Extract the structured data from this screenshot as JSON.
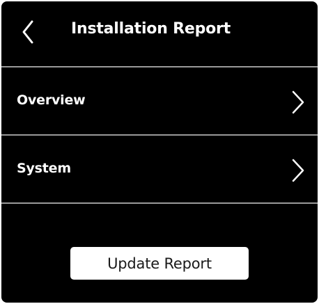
{
  "header": {
    "title": "Installation Report",
    "back_icon": "chevron-left-icon"
  },
  "menu": {
    "items": [
      {
        "label": "Overview",
        "icon": "chevron-right-icon"
      },
      {
        "label": "System",
        "icon": "chevron-right-icon"
      }
    ]
  },
  "actions": {
    "update_label": "Update Report"
  },
  "colors": {
    "background": "#000000",
    "text": "#ffffff",
    "divider": "#9a9a9a",
    "button_bg": "#ffffff",
    "button_text": "#1a1a1a"
  }
}
